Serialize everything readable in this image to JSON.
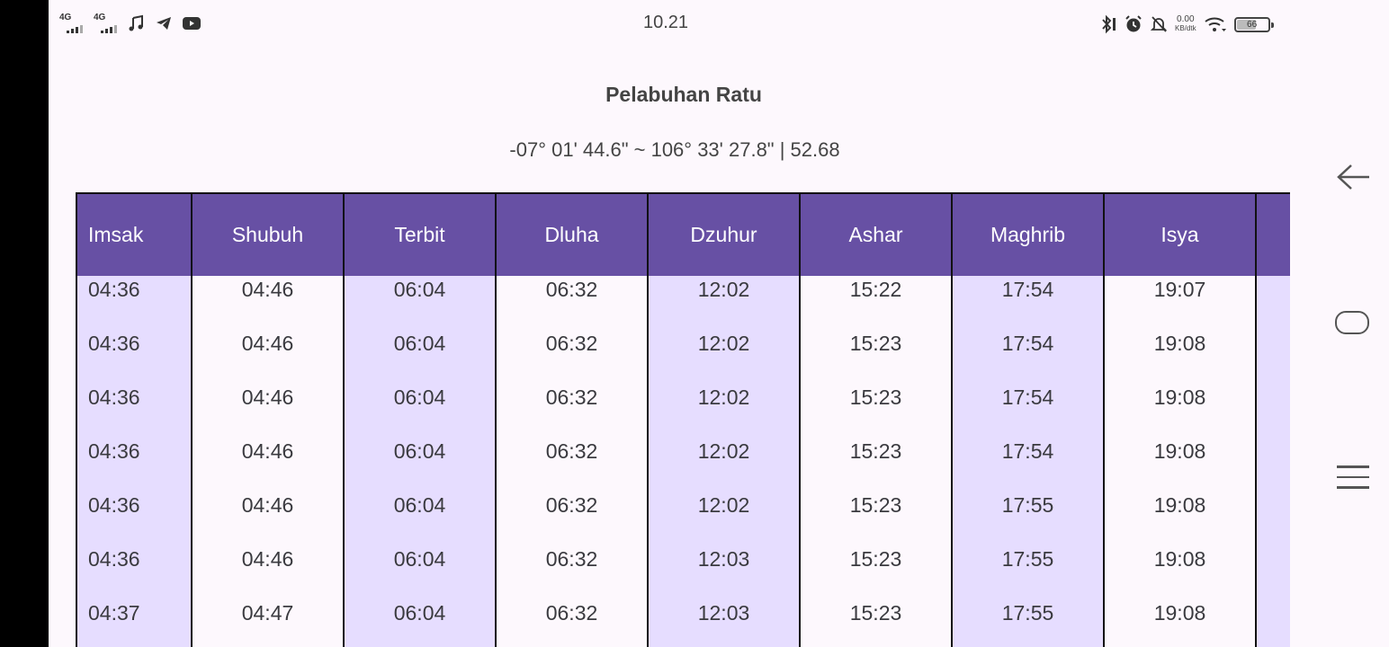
{
  "status_bar": {
    "time": "10.21",
    "sim1_label": "4G",
    "sim2_label": "4G",
    "net_speed_value": "0.00",
    "net_speed_unit": "KB/dtk",
    "battery_level": "66",
    "icons_left": [
      "signal-icon",
      "signal-icon",
      "music-note-icon",
      "telegram-icon",
      "youtube-icon"
    ],
    "icons_right": [
      "bluetooth-icon",
      "alarm-icon",
      "mute-notification-icon",
      "wifi-icon",
      "battery-icon"
    ]
  },
  "location": {
    "name": "Pelabuhan Ratu",
    "coordinates": "-07° 01' 44.6\" ~ 106° 33' 27.8\" | 52.68"
  },
  "colors": {
    "header_bg": "#6750a4",
    "shaded_col": "#e6ddff",
    "page_bg": "#fdf8fd"
  },
  "table": {
    "headers": [
      "Imsak",
      "Shubuh",
      "Terbit",
      "Dluha",
      "Dzuhur",
      "Ashar",
      "Maghrib",
      "Isya"
    ],
    "rows": [
      [
        "04:36",
        "04:46",
        "06:04",
        "06:32",
        "12:02",
        "15:22",
        "17:54",
        "19:07"
      ],
      [
        "04:36",
        "04:46",
        "06:04",
        "06:32",
        "12:02",
        "15:23",
        "17:54",
        "19:08"
      ],
      [
        "04:36",
        "04:46",
        "06:04",
        "06:32",
        "12:02",
        "15:23",
        "17:54",
        "19:08"
      ],
      [
        "04:36",
        "04:46",
        "06:04",
        "06:32",
        "12:02",
        "15:23",
        "17:54",
        "19:08"
      ],
      [
        "04:36",
        "04:46",
        "06:04",
        "06:32",
        "12:02",
        "15:23",
        "17:55",
        "19:08"
      ],
      [
        "04:36",
        "04:46",
        "06:04",
        "06:32",
        "12:03",
        "15:23",
        "17:55",
        "19:08"
      ],
      [
        "04:37",
        "04:47",
        "06:04",
        "06:32",
        "12:03",
        "15:23",
        "17:55",
        "19:08"
      ]
    ]
  },
  "navigation": {
    "icons": [
      "back-icon",
      "home-icon",
      "menu-icon"
    ]
  }
}
